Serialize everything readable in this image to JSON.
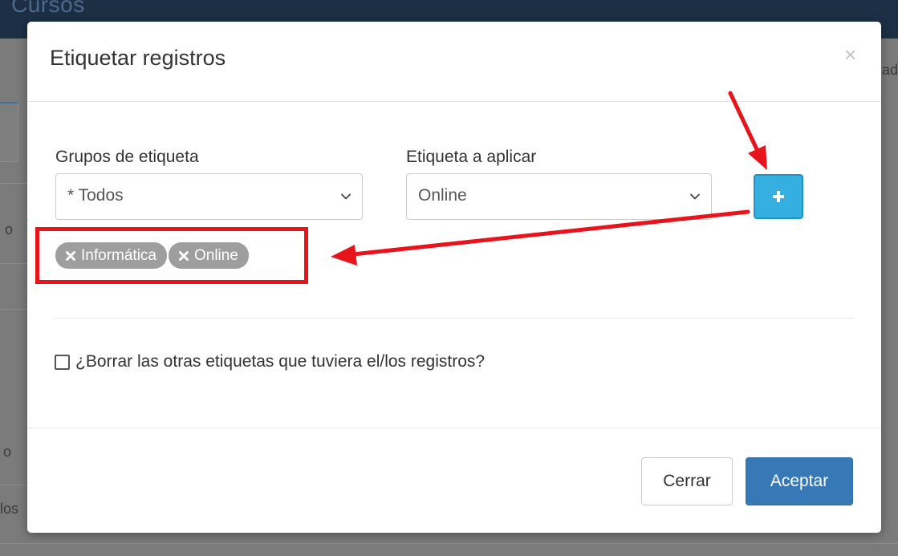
{
  "background": {
    "title": "Cursos",
    "right_fragment": "ad",
    "side_fragments": [
      "o",
      "o",
      "los"
    ]
  },
  "modal": {
    "title": "Etiquetar registros",
    "close_glyph": "×",
    "group_field": {
      "label": "Grupos de etiqueta",
      "value": "* Todos"
    },
    "tag_field": {
      "label": "Etiqueta a aplicar",
      "value": "Online"
    },
    "add_button_glyph": "+",
    "applied_tags": [
      {
        "label": "Informática"
      },
      {
        "label": "Online"
      }
    ],
    "delete_others_checkbox": {
      "label": "¿Borrar las otras etiquetas que tuviera el/los registros?",
      "checked": false
    },
    "footer": {
      "close_label": "Cerrar",
      "accept_label": "Aceptar"
    }
  },
  "colors": {
    "accent": "#3779b7",
    "add_button": "#35aee0",
    "tag_bg": "#9e9e9e",
    "annotation": "#e8141c"
  }
}
